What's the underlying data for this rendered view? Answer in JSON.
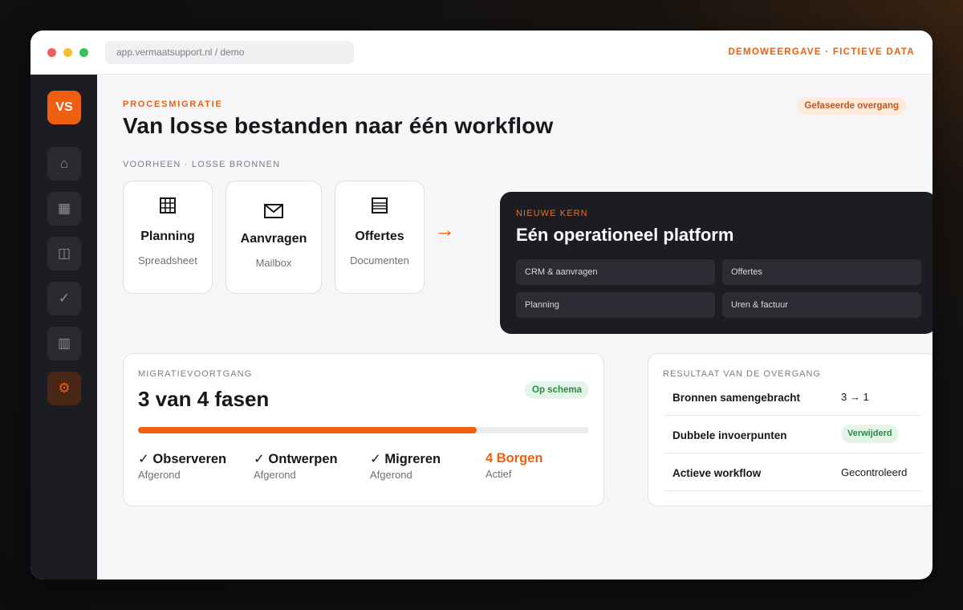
{
  "browser": {
    "url": "app.vermaatsupport.nl / demo",
    "demo_label": "DEMOWEERGAVE · FICTIEVE DATA"
  },
  "sidebar": {
    "logo": "VS",
    "items": [
      {
        "icon": "home-icon",
        "glyph": "⌂"
      },
      {
        "icon": "grid-icon",
        "glyph": "▦"
      },
      {
        "icon": "columns-icon",
        "glyph": "◫"
      },
      {
        "icon": "check-icon",
        "glyph": "✓"
      },
      {
        "icon": "board-icon",
        "glyph": "▥"
      },
      {
        "icon": "gear-icon",
        "glyph": "⚙"
      }
    ]
  },
  "header": {
    "eyebrow": "PROCESMIGRATIE",
    "title": "Van losse bestanden naar één workflow",
    "phase_badge": "Gefaseerde overgang"
  },
  "sources": {
    "label": "VOORHEEN · LOSSE BRONNEN",
    "items": [
      {
        "title": "Planning",
        "subtitle": "Spreadsheet",
        "icon": "spreadsheet-icon"
      },
      {
        "title": "Aanvragen",
        "subtitle": "Mailbox",
        "icon": "mail-icon"
      },
      {
        "title": "Offertes",
        "subtitle": "Documenten",
        "icon": "document-icon"
      }
    ]
  },
  "arrow": "→",
  "core": {
    "eyebrow": "NIEUWE KERN",
    "title": "Eén operationeel platform",
    "modules": [
      "CRM & aanvragen",
      "Offertes",
      "Planning",
      "Uren & factuur"
    ]
  },
  "progress": {
    "label": "MIGRATIEVOORTGANG",
    "stat": "3 van 4 fasen",
    "badge": "Op schema",
    "fill_fraction": 0.75,
    "phases": [
      {
        "name": "✓ Observeren",
        "status": "Afgerond",
        "current": false
      },
      {
        "name": "✓ Ontwerpen",
        "status": "Afgerond",
        "current": false
      },
      {
        "name": "✓ Migreren",
        "status": "Afgerond",
        "current": false
      },
      {
        "name": "4 Borgen",
        "status": "Actief",
        "current": true
      }
    ]
  },
  "results": {
    "label": "RESULTAAT VAN DE OVERGANG",
    "rows": [
      {
        "key": "Bronnen samengebracht",
        "value": "3 → 1",
        "badge": false
      },
      {
        "key": "Dubbele invoerpunten",
        "value": "Verwijderd",
        "badge": true
      },
      {
        "key": "Actieve workflow",
        "value": "Gecontroleerd",
        "badge": false
      }
    ]
  },
  "colors": {
    "accent": "#ee5f0f",
    "dark": "#1c1d22",
    "success": "#268a43"
  }
}
